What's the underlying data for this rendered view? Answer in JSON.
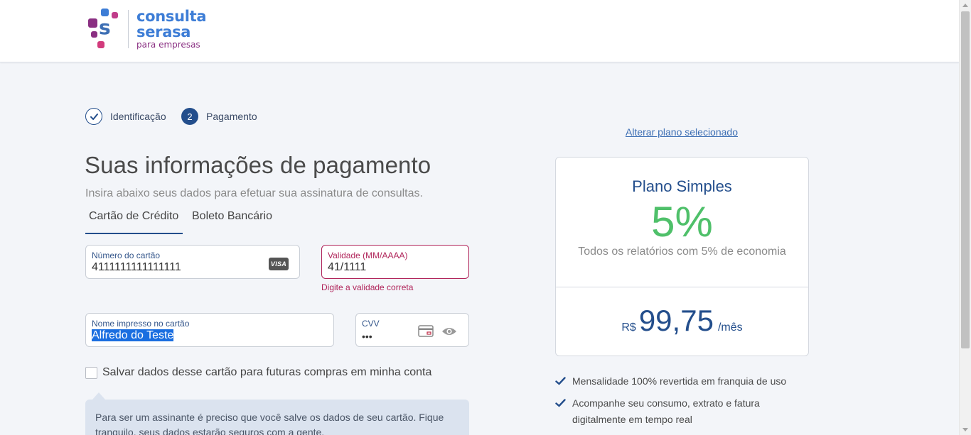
{
  "header": {
    "logo": {
      "line1": "consulta",
      "line2": "serasa",
      "line3": "para empresas"
    }
  },
  "stepper": {
    "step1": {
      "label": "Identificação",
      "icon": "check-icon"
    },
    "step2": {
      "number": "2",
      "label": "Pagamento"
    }
  },
  "page": {
    "title": "Suas informações de pagamento",
    "subtitle": "Insira abaixo seus dados para efetuar sua assinatura de consultas."
  },
  "tabs": [
    {
      "label": "Cartão de Crédito",
      "active": true
    },
    {
      "label": "Boleto Bancário",
      "active": false
    }
  ],
  "form": {
    "card_number": {
      "label": "Número do cartão",
      "value": "4111111111111111",
      "brand": "VISA"
    },
    "validity": {
      "label": "Validade (MM/AAAA)",
      "value": "41/1111",
      "error": "Digite a validade correta"
    },
    "name": {
      "label": "Nome impresso no cartão",
      "value": "Alfredo do Teste"
    },
    "cvv": {
      "label": "CVV",
      "value": "•••"
    },
    "save_card": {
      "label": "Salvar dados desse cartão para futuras compras em minha conta",
      "checked": false
    },
    "tooltip": "Para ser um assinante é preciso que você salve os dados de seu cartão. Fique tranquilo, seus dados estarão seguros com a gente."
  },
  "plan": {
    "change_link": "Alterar plano selecionado",
    "name": "Plano Simples",
    "percent": "5%",
    "description": "Todos os relatórios com 5% de economia",
    "currency": "R$",
    "price": "99,75",
    "period": "/mês",
    "benefits": [
      "Mensalidade 100% revertida em franquia de uso",
      "Acompanhe seu consumo, extrato e fatura digitalmente em tempo real"
    ]
  },
  "colors": {
    "brand_blue": "#234e8c",
    "success_green": "#4fc06a",
    "error_red": "#b0245a",
    "logo_purple": "#8a2f82"
  }
}
